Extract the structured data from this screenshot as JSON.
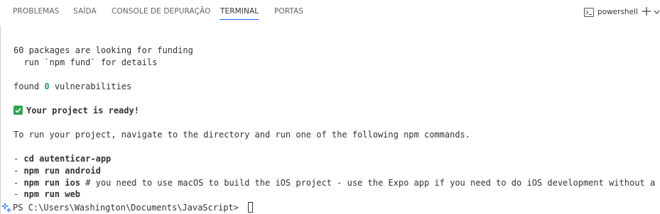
{
  "panel_tabs": [
    {
      "label": "PROBLEMAS"
    },
    {
      "label": "SAÍDA"
    },
    {
      "label": "CONSOLE DE DEPURAÇÃO"
    },
    {
      "label": "TERMINAL"
    },
    {
      "label": "PORTAS"
    }
  ],
  "active_tab": "TERMINAL",
  "terminal_profile": {
    "label": "powershell",
    "icon": "terminal-icon"
  },
  "toolbar_icons": [
    "plus-icon",
    "chevron-down-icon"
  ],
  "output": {
    "funding_line": "60 packages are looking for funding",
    "funding_details": "  run `npm fund` for details",
    "found_prefix": "found ",
    "found_count": "0",
    "found_suffix": " vulnerabilities",
    "ready_message": "Your project is ready!",
    "instructions": "To run your project, navigate to the directory and run one of the following npm commands.",
    "commands": [
      {
        "prefix": "- ",
        "cmd": "cd autenticar-app",
        "rest": ""
      },
      {
        "prefix": "- ",
        "cmd": "npm run android",
        "rest": ""
      },
      {
        "prefix": "- ",
        "cmd": "npm run ios",
        "rest": " # you need to use macOS to build the iOS project - use the Expo app if you need to do iOS development without a Mac"
      },
      {
        "prefix": "- ",
        "cmd": "npm run web",
        "rest": ""
      }
    ]
  },
  "prompt": "PS C:\\Users\\Washington\\Documents\\JavaScript> ",
  "colors": {
    "accent": "#1f6feb",
    "success": "#2ea44f",
    "count": "#14a36a"
  }
}
